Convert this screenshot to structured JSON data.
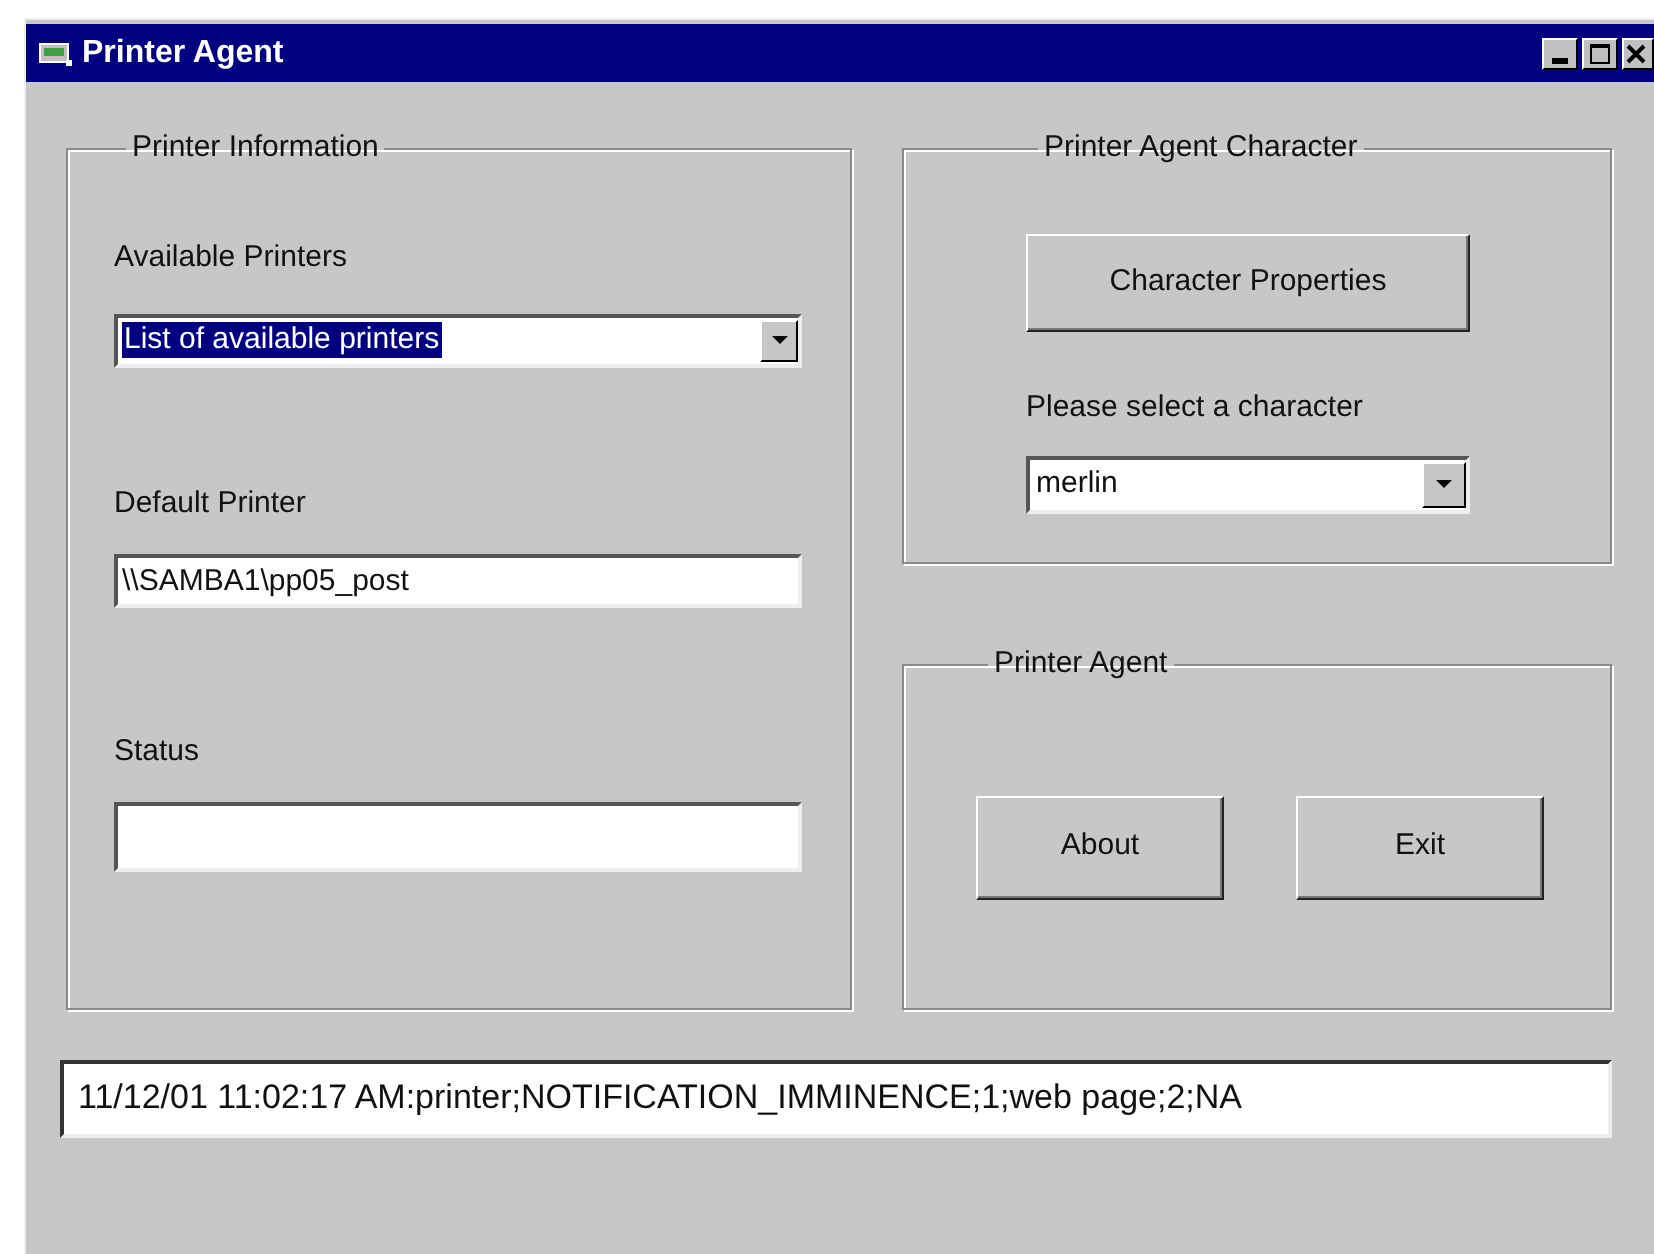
{
  "window": {
    "title": "Printer Agent"
  },
  "printer_information": {
    "title": "Printer Information",
    "available_printers": {
      "label": "Available Printers",
      "value": "List of available printers",
      "selected": true
    },
    "default_printer": {
      "label": "Default Printer",
      "value": "\\\\SAMBA1\\pp05_post"
    },
    "status": {
      "label": "Status"
    }
  },
  "printer_agent_character": {
    "title": "Printer Agent Character",
    "button": "Character Properties",
    "label": "Please select a character",
    "character": {
      "value": "merlin",
      "selected": false
    }
  },
  "printer_agent": {
    "title": "Printer Agent",
    "buttons": [
      "About",
      "Exit"
    ]
  },
  "log": "11/12/01 11:02:17 AM:printer;NOTIFICATION_IMMINENCE;1;web page;2;NA"
}
